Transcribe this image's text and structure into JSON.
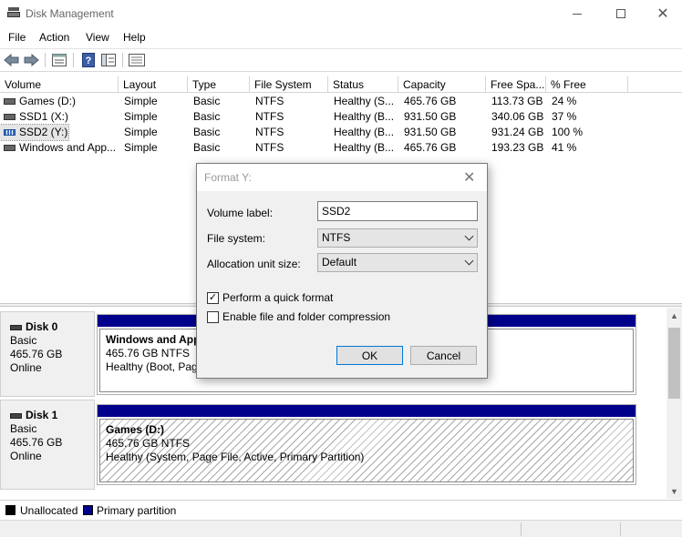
{
  "window": {
    "title": "Disk Management",
    "minimize_icon": "minimize-icon",
    "maximize_icon": "maximize-icon",
    "close_glyph": "✕"
  },
  "menu": [
    "File",
    "Action",
    "View",
    "Help"
  ],
  "toolbar": {
    "icons": [
      "back-arrow-icon",
      "forward-arrow-icon",
      "properties-icon",
      "help-icon",
      "console-icon",
      "settings-list-icon"
    ]
  },
  "volumes": {
    "columns": [
      "Volume",
      "Layout",
      "Type",
      "File System",
      "Status",
      "Capacity",
      "Free Spa...",
      "% Free"
    ],
    "rows": [
      {
        "volume": "Games (D:)",
        "layout": "Simple",
        "type": "Basic",
        "fs": "NTFS",
        "status": "Healthy (S...",
        "capacity": "465.76 GB",
        "free": "113.73 GB",
        "pct": "24 %",
        "icon": "hdd"
      },
      {
        "volume": "SSD1 (X:)",
        "layout": "Simple",
        "type": "Basic",
        "fs": "NTFS",
        "status": "Healthy (B...",
        "capacity": "931.50 GB",
        "free": "340.06 GB",
        "pct": "37 %",
        "icon": "hdd"
      },
      {
        "volume": "SSD2 (Y:)",
        "layout": "Simple",
        "type": "Basic",
        "fs": "NTFS",
        "status": "Healthy (B...",
        "capacity": "931.50 GB",
        "free": "931.24 GB",
        "pct": "100 %",
        "icon": "ssd"
      },
      {
        "volume": "Windows and App...",
        "layout": "Simple",
        "type": "Basic",
        "fs": "NTFS",
        "status": "Healthy (B...",
        "capacity": "465.76 GB",
        "free": "193.23 GB",
        "pct": "41 %",
        "icon": "hdd"
      }
    ]
  },
  "disks": [
    {
      "name": "Disk 0",
      "type": "Basic",
      "size": "465.76 GB",
      "state": "Online",
      "partition": {
        "name": "Windows and Apps",
        "size_fs": "465.76 GB NTFS",
        "status": "Healthy (Boot, Page"
      }
    },
    {
      "name": "Disk 1",
      "type": "Basic",
      "size": "465.76 GB",
      "state": "Online",
      "partition": {
        "name": "Games  (D:)",
        "size_fs": "465.76 GB NTFS",
        "status": "Healthy (System, Page File, Active, Primary Partition)"
      }
    }
  ],
  "legend": [
    {
      "label": "Unallocated",
      "color": "#000000"
    },
    {
      "label": "Primary partition",
      "color": "#00008b"
    }
  ],
  "dialog": {
    "title": "Format Y:",
    "volume_label_caption": "Volume label:",
    "volume_label_value": "SSD2",
    "file_system_caption": "File system:",
    "file_system_value": "NTFS",
    "alloc_caption": "Allocation unit size:",
    "alloc_value": "Default",
    "quick_format_label": "Perform a quick format",
    "quick_format_checked": true,
    "compression_label": "Enable file and folder compression",
    "compression_checked": false,
    "ok_label": "OK",
    "cancel_label": "Cancel"
  }
}
